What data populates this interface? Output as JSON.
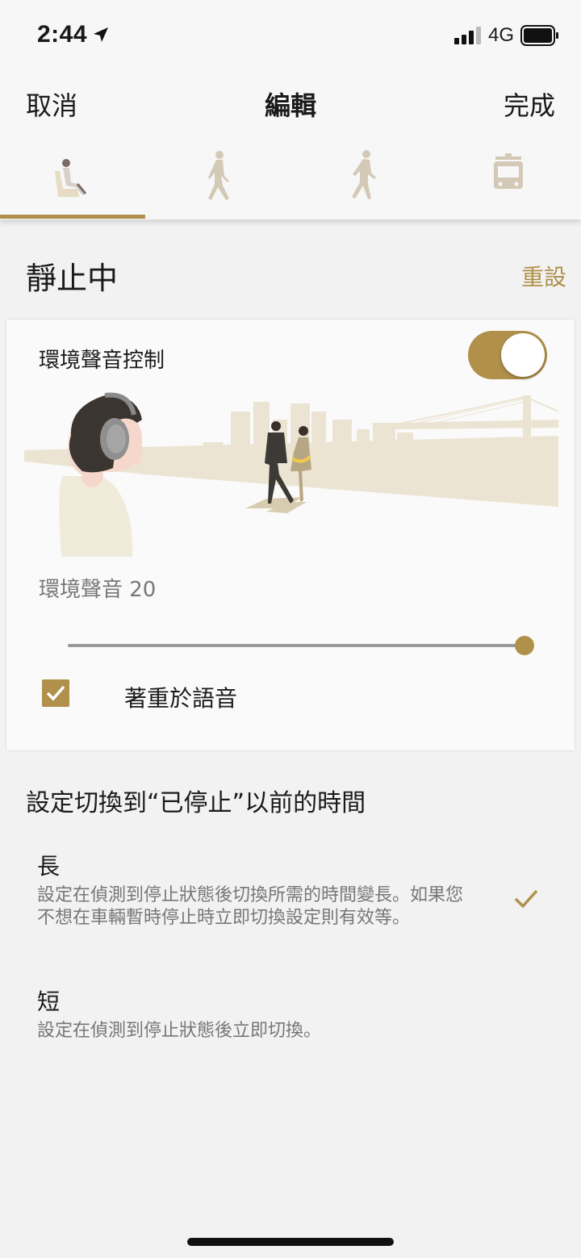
{
  "status_bar": {
    "time": "2:44",
    "network": "4G"
  },
  "nav": {
    "cancel_label": "取消",
    "title": "編輯",
    "done_label": "完成"
  },
  "tabs": [
    {
      "icon": "sitting-person-icon",
      "selected": true
    },
    {
      "icon": "walking-person-icon",
      "selected": false
    },
    {
      "icon": "running-person-icon",
      "selected": false
    },
    {
      "icon": "train-icon",
      "selected": false
    }
  ],
  "section": {
    "title": "靜止中",
    "reset_label": "重設"
  },
  "ambient_card": {
    "label": "環境聲音控制",
    "toggle_on": true,
    "level_label": "環境聲音 20",
    "slider_value": 20,
    "slider_max": 20,
    "voice_focus_checked": true,
    "voice_focus_label": "著重於語音"
  },
  "timing": {
    "title": "設定切換到“已停止”以前的時間",
    "options": [
      {
        "title": "長",
        "description": "設定在偵測到停止狀態後切換所需的時間變長。如果您不想在車輛暫時停止時立即切換設定則有效等。",
        "selected": true
      },
      {
        "title": "短",
        "description": "設定在偵測到停止狀態後立即切換。",
        "selected": false
      }
    ]
  },
  "colors": {
    "accent": "#b0904a",
    "background": "#f2f2f2",
    "card": "#fafafa"
  }
}
